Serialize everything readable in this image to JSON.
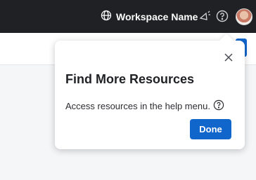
{
  "topbar": {
    "workspace_name": "Workspace Name",
    "icons": [
      "globe-icon",
      "announcement-icon",
      "help-icon",
      "avatar"
    ]
  },
  "popup": {
    "close_icon": "close-icon",
    "title": "Find More Resources",
    "body": "Access resources in the help menu.",
    "body_icon": "help-icon",
    "done_label": "Done"
  },
  "colors": {
    "topbar_bg": "#1f2124",
    "primary": "#1166cc",
    "page_bg": "#f5f6f8"
  }
}
